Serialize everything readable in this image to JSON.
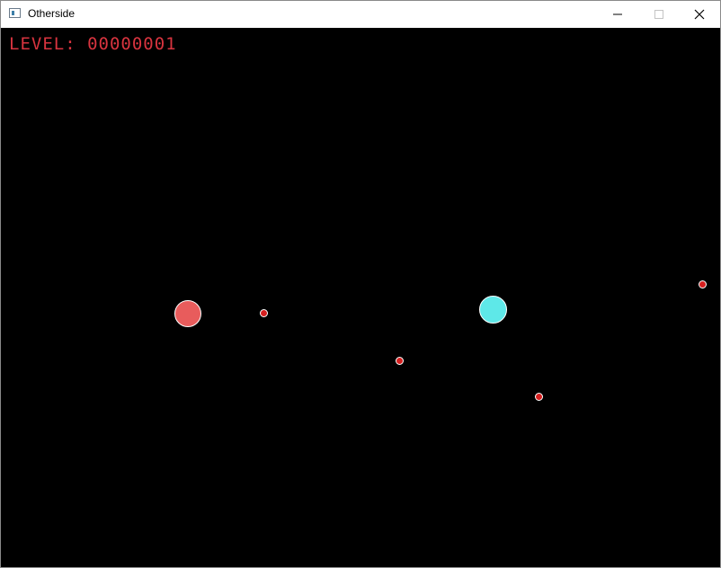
{
  "window": {
    "title": "Otherside",
    "icon": "app-window-icon",
    "controls": {
      "minimize_icon": "minimize-icon",
      "maximize_icon": "maximize-icon",
      "close_icon": "close-icon"
    }
  },
  "hud": {
    "level_text": "LEVEL: 00000001",
    "level_color": "#d8343f"
  },
  "game": {
    "background_color": "#000000",
    "player_color": "#e85c5c",
    "portal_color": "#5ee8e8",
    "enemy_color": "#d51f1f"
  }
}
